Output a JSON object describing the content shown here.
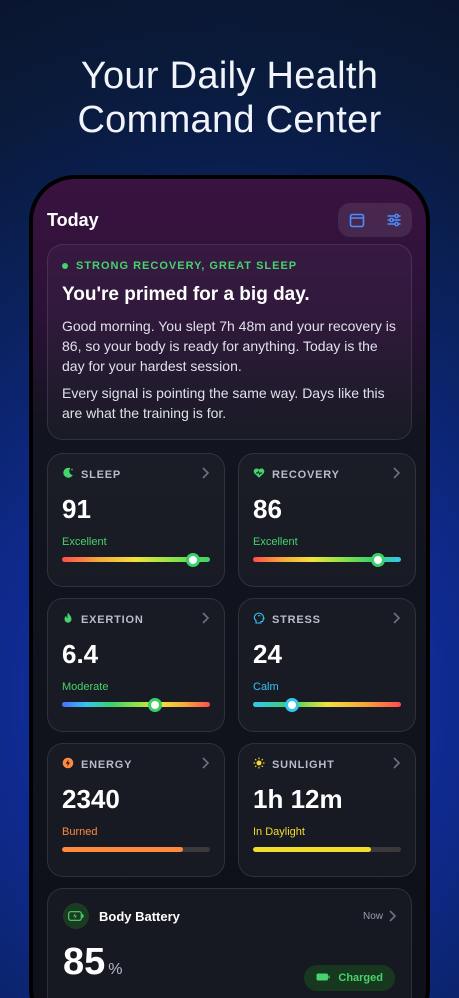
{
  "headline": {
    "line1": "Your Daily Health",
    "line2": "Command Center"
  },
  "topbar": {
    "title": "Today",
    "actions": [
      "calendar-icon",
      "sliders-icon"
    ]
  },
  "summary": {
    "tag": "STRONG RECOVERY, GREAT SLEEP",
    "title": "You're primed for a big day.",
    "paragraph1": "Good morning. You slept 7h 48m and your recovery is 86, so your body is ready for anything. Today is the day for your hardest session.",
    "paragraph2": "Every signal is pointing the same way. Days like this are what the training is for."
  },
  "metrics": [
    {
      "label": "SLEEP",
      "icon": "moon-icon",
      "value": "91",
      "status": "Excellent",
      "status_color": "#45d46b",
      "bar_fraction": 0.87
    },
    {
      "label": "RECOVERY",
      "icon": "heart-icon",
      "value": "86",
      "status": "Excellent",
      "status_color": "#45d46b",
      "bar_fraction": 0.83
    },
    {
      "label": "EXERTION",
      "icon": "flame-icon",
      "value": "6.4",
      "status": "Moderate",
      "status_color": "#45d46b",
      "bar_fraction": 0.62
    },
    {
      "label": "STRESS",
      "icon": "head-icon",
      "value": "24",
      "status": "Calm",
      "status_color": "#35c6f0",
      "bar_fraction": 0.26
    },
    {
      "label": "ENERGY",
      "icon": "bolt-coin-icon",
      "value": "2340",
      "status": "Burned",
      "status_color": "#ff8a3d",
      "bar_fraction": 0.82
    },
    {
      "label": "SUNLIGHT",
      "icon": "sun-icon",
      "value": "1h 12m",
      "status": "In Daylight",
      "status_color": "#f3dc2a",
      "bar_fraction": 0.8
    }
  ],
  "battery": {
    "title": "Body Battery",
    "time": "Now",
    "value": "85",
    "unit": "%",
    "status": "Charged"
  },
  "colors": {
    "accent_green": "#45d46b",
    "energy_orange": "#ff8a3d",
    "sunlight_yellow": "#f3dc2a",
    "stress_blue": "#35c6f0",
    "icon_blue": "#4c8dff"
  }
}
